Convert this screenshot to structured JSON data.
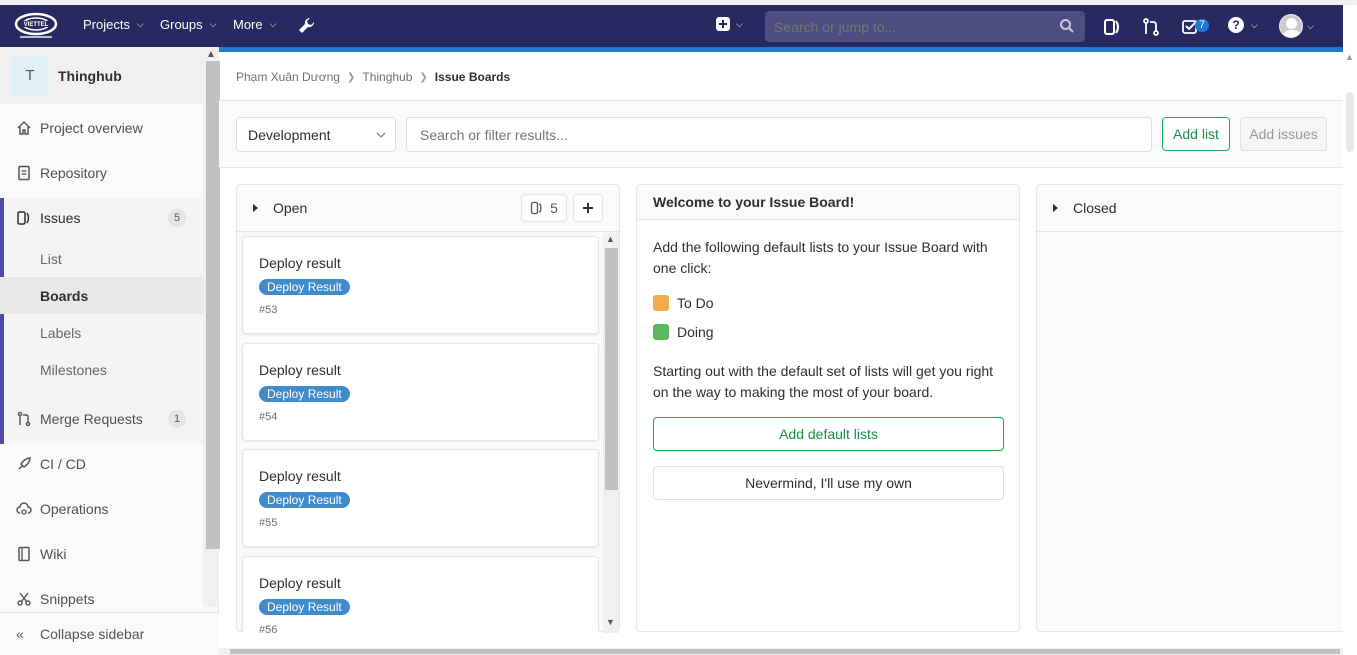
{
  "navbar": {
    "links": [
      {
        "label": "Projects"
      },
      {
        "label": "Groups"
      },
      {
        "label": "More"
      }
    ],
    "search_placeholder": "Search or jump to...",
    "todo_count": "7",
    "colors": {
      "bg": "#292961",
      "accent": "#1f78d1"
    }
  },
  "sidebar": {
    "project_avatar": "T",
    "project_name": "Thinghub",
    "items": [
      {
        "label": "Project overview",
        "icon": "home-icon"
      },
      {
        "label": "Repository",
        "icon": "doc-icon"
      },
      {
        "label": "Issues",
        "icon": "issues-icon",
        "count": "5"
      },
      {
        "label": "Merge Requests",
        "icon": "merge-request-icon",
        "count": "1"
      },
      {
        "label": "CI / CD",
        "icon": "rocket-icon"
      },
      {
        "label": "Operations",
        "icon": "cloud-gear-icon"
      },
      {
        "label": "Wiki",
        "icon": "book-icon"
      },
      {
        "label": "Snippets",
        "icon": "scissors-icon"
      }
    ],
    "issues_sub": [
      {
        "label": "List"
      },
      {
        "label": "Boards"
      },
      {
        "label": "Labels"
      },
      {
        "label": "Milestones"
      }
    ],
    "collapse_label": "Collapse sidebar"
  },
  "breadcrumb": {
    "user": "Phạm Xuân Dương",
    "project": "Thinghub",
    "current": "Issue Boards"
  },
  "filters": {
    "board": "Development",
    "search_placeholder": "Search or filter results...",
    "add_list": "Add list",
    "add_issues": "Add issues"
  },
  "open_list": {
    "title": "Open",
    "count": "5",
    "cards": [
      {
        "title": "Deploy result",
        "label": "Deploy Result",
        "number": "#53"
      },
      {
        "title": "Deploy result",
        "label": "Deploy Result",
        "number": "#54"
      },
      {
        "title": "Deploy result",
        "label": "Deploy Result",
        "number": "#55"
      },
      {
        "title": "Deploy result",
        "label": "Deploy Result",
        "number": "#56"
      }
    ],
    "label_color": "#428bca"
  },
  "welcome": {
    "title": "Welcome to your Issue Board!",
    "intro": "Add the following default lists to your Issue Board with one click:",
    "options": [
      {
        "label": "To Do",
        "color": "#f0ad4e"
      },
      {
        "label": "Doing",
        "color": "#5cb85c"
      }
    ],
    "explain": "Starting out with the default set of lists will get you right on the way to making the most of your board.",
    "add_default": "Add default lists",
    "nevermind": "Nevermind, I'll use my own"
  },
  "closed_list": {
    "title": "Closed"
  }
}
